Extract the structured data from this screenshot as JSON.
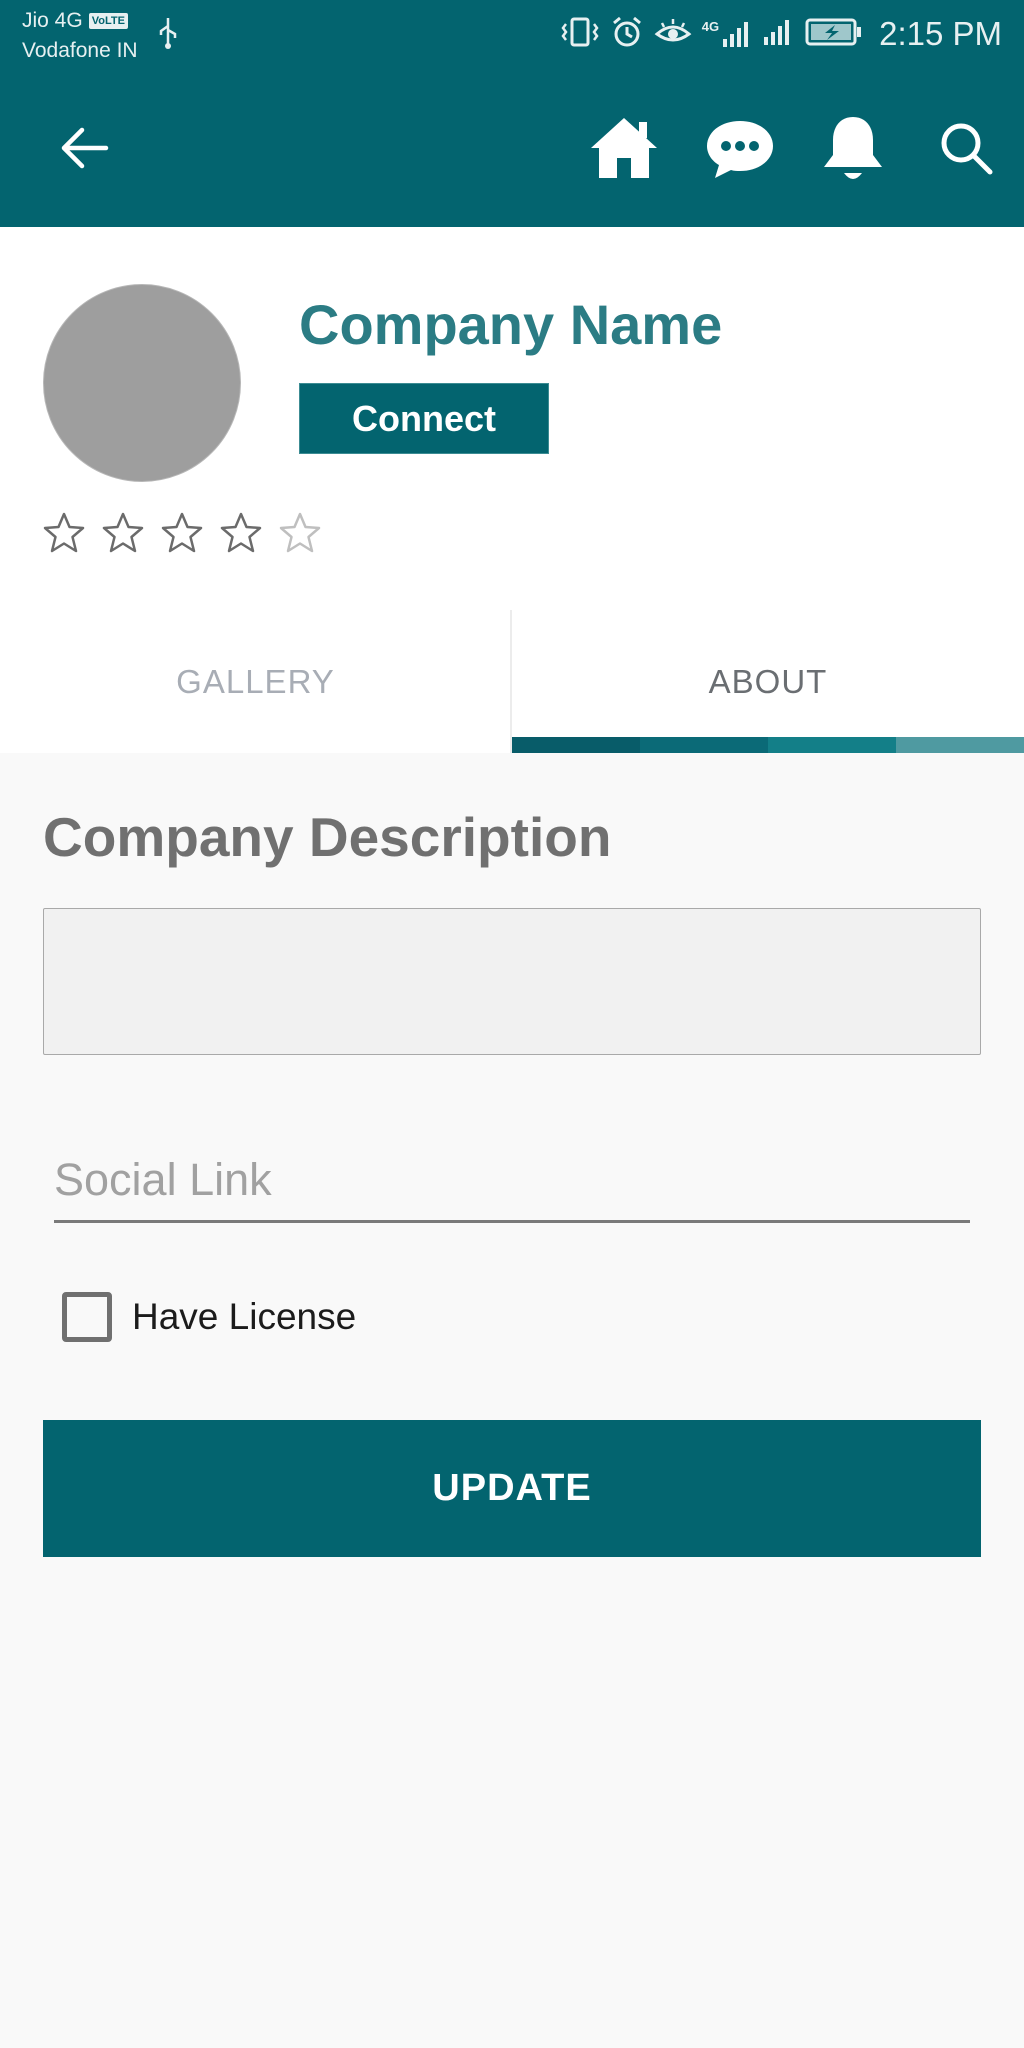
{
  "status_bar": {
    "carrier1": "Jio 4G",
    "volte": "VoLTE",
    "carrier2": "Vodafone IN",
    "network": "4G",
    "time": "2:15 PM"
  },
  "app_bar": {
    "icons": [
      "back-arrow-icon",
      "home-icon",
      "chat-icon",
      "bell-icon",
      "search-icon"
    ]
  },
  "profile": {
    "company_name": "Company Name",
    "connect_label": "Connect",
    "rating": {
      "filled": 4,
      "max": 5
    }
  },
  "tabs": [
    {
      "label": "GALLERY",
      "active": false
    },
    {
      "label": "ABOUT",
      "active": true
    }
  ],
  "about": {
    "section_title": "Company Description",
    "description_value": "",
    "social_placeholder": "Social Link",
    "license_label": "Have License",
    "license_checked": false,
    "update_label": "UPDATE"
  },
  "colors": {
    "primary": "#03646f",
    "accent_text": "#2b7c84",
    "indicator": [
      "#085c69",
      "#0b6a77",
      "#137f88",
      "#4f9aa1"
    ]
  }
}
